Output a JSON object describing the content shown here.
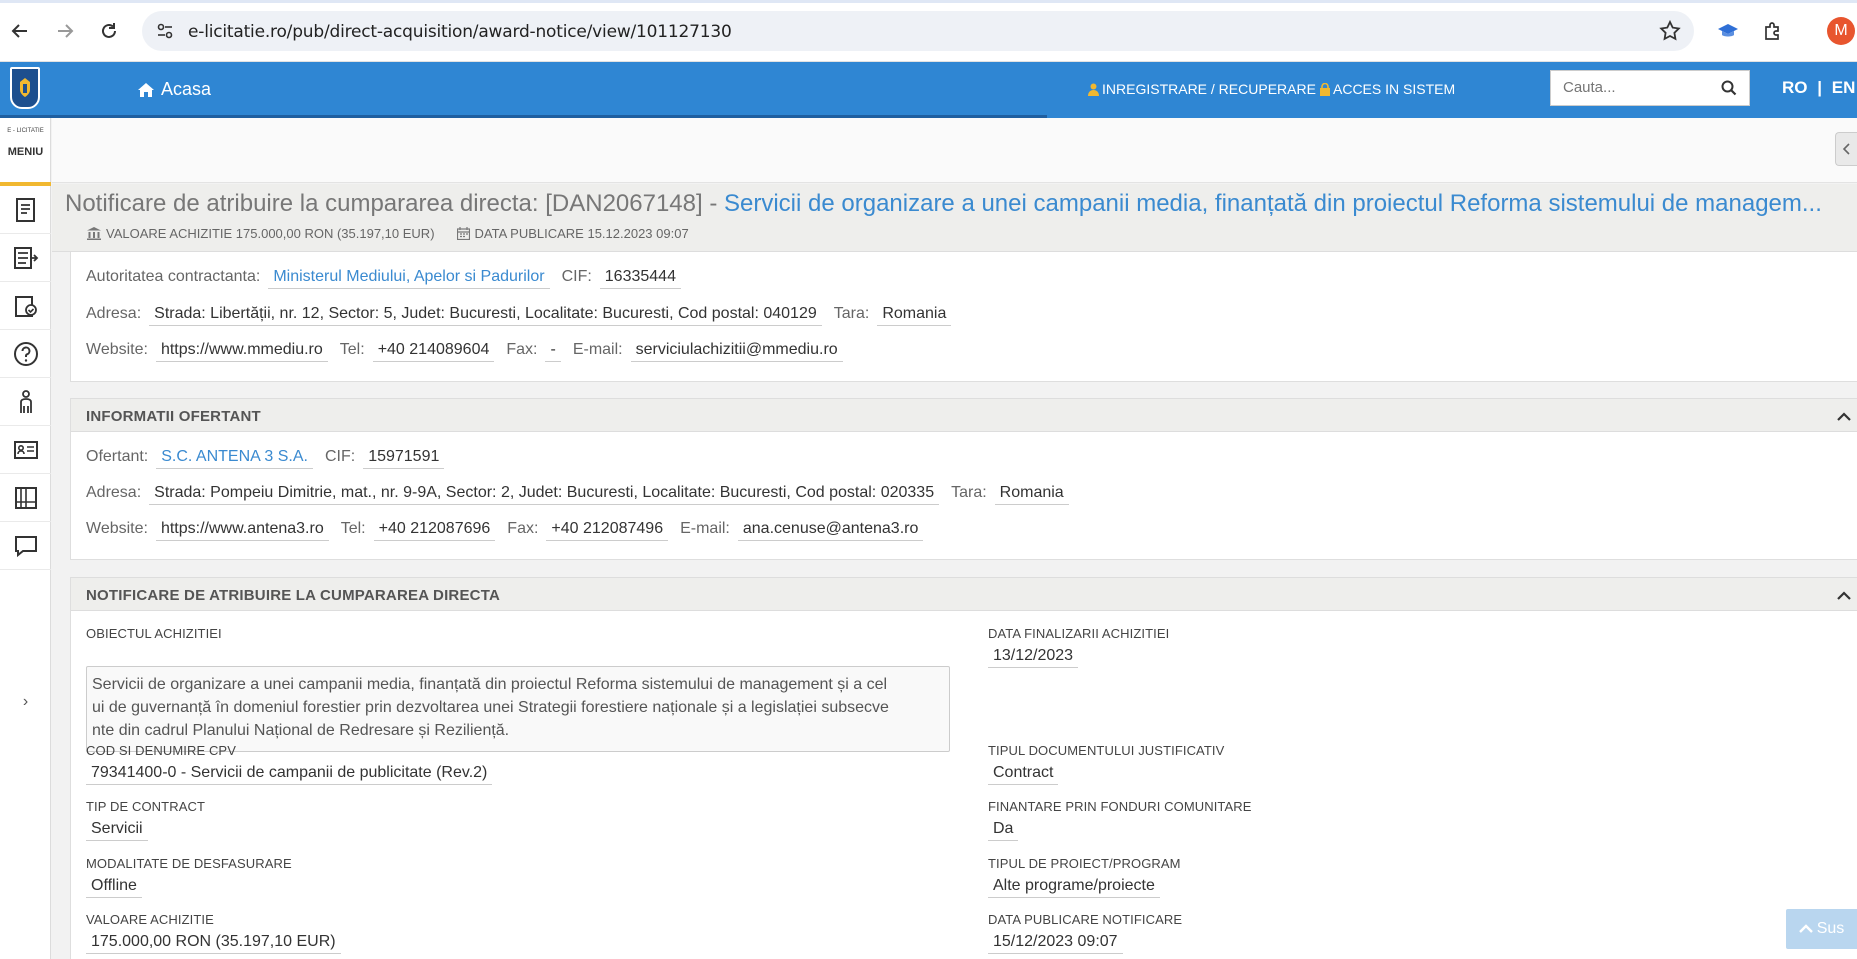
{
  "browser": {
    "url": "e-licitatie.ro/pub/direct-acquisition/award-notice/view/101127130",
    "profile_initial": "M"
  },
  "header": {
    "home_label": "Acasa",
    "register_label": "INREGISTRARE / RECUPERARE",
    "login_label": "ACCES IN SISTEM",
    "search_placeholder": "Cauta...",
    "lang_ro": "RO",
    "lang_sep": "|",
    "lang_en": "EN"
  },
  "sidebar": {
    "brand": "E - LICITATIE",
    "menu_label": "MENIU",
    "expand_label": "›"
  },
  "page": {
    "title_prefix": "Notificare de atribuire la cumpararea directa: [DAN2067148] - ",
    "title_link": "Servicii de organizare a unei campanii media, finanțată din proiectul Reforma sistemului de managem...",
    "value_meta": "VALOARE ACHIZITIE 175.000,00 RON (35.197,10 EUR)",
    "date_meta": "DATA PUBLICARE 15.12.2023 09:07"
  },
  "authority": {
    "label": "Autoritatea contractanta:",
    "name": "Ministerul Mediului, Apelor si Padurilor",
    "cif_label": "CIF:",
    "cif": "16335444",
    "address_label": "Adresa:",
    "address": "Strada: Libertății, nr. 12, Sector: 5, Judet: Bucuresti, Localitate: Bucuresti, Cod postal: 040129",
    "country_label": "Tara:",
    "country": "Romania",
    "website_label": "Website:",
    "website": "https://www.mmediu.ro",
    "tel_label": "Tel:",
    "tel": "+40 214089604",
    "fax_label": "Fax:",
    "fax": "-",
    "email_label": "E-mail:",
    "email": "serviciulachizitii@mmediu.ro"
  },
  "bidder": {
    "section_title": "INFORMATII OFERTANT",
    "label": "Ofertant:",
    "name": "S.C. ANTENA 3 S.A.",
    "cif_label": "CIF:",
    "cif": "15971591",
    "address_label": "Adresa:",
    "address": "Strada: Pompeiu Dimitrie, mat., nr. 9-9A, Sector: 2, Judet: Bucuresti, Localitate: Bucuresti, Cod postal: 020335",
    "country_label": "Tara:",
    "country": "Romania",
    "website_label": "Website:",
    "website": "https://www.antena3.ro",
    "tel_label": "Tel:",
    "tel": "+40 212087696",
    "fax_label": "Fax:",
    "fax": "+40 212087496",
    "email_label": "E-mail:",
    "email": "ana.cenuse@antena3.ro"
  },
  "notice": {
    "section_title": "NOTIFICARE DE ATRIBUIRE LA CUMPARAREA DIRECTA",
    "object_label": "OBIECTUL ACHIZITIEI",
    "object_line1": "Servicii de organizare a unei campanii media, finanțată din proiectul Reforma sistemului de management și a cel",
    "object_line2": "ui de guvernanță în domeniul forestier prin dezvoltarea unei Strategii forestiere naționale și a legislației subsecve",
    "object_line3": "nte din cadrul Planului Național de Redresare și Reziliență.",
    "end_date_label": "DATA FINALIZARII ACHIZITIEI",
    "end_date": "13/12/2023",
    "cpv_label": "COD SI DENUMIRE CPV",
    "cpv": "79341400-0 - Servicii de campanii de publicitate (Rev.2)",
    "doc_type_label": "TIPUL DOCUMENTULUI JUSTIFICATIV",
    "doc_type": "Contract",
    "contract_type_label": "TIP DE CONTRACT",
    "contract_type": "Servicii",
    "eu_funds_label": "FINANTARE PRIN FONDURI COMUNITARE",
    "eu_funds": "Da",
    "mode_label": "MODALITATE DE DESFASURARE",
    "mode": "Offline",
    "project_type_label": "TIPUL DE PROIECT/PROGRAM",
    "project_type": "Alte programe/proiecte",
    "value_label": "VALOARE ACHIZITIE",
    "value": "175.000,00 RON (35.197,10 EUR)",
    "pub_date_label": "DATA PUBLICARE NOTIFICARE",
    "pub_date": "15/12/2023 09:07"
  },
  "scroll_top_label": "Sus",
  "colors": {
    "header_blue": "#2f86d3",
    "link_blue": "#3a8ad0",
    "accent_yellow": "#f1b830"
  }
}
